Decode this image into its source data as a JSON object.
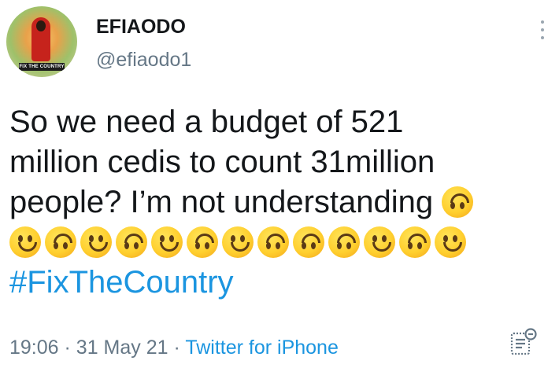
{
  "user": {
    "display_name": "EFIAODO",
    "handle": "@efiaodo1",
    "avatar_caption": "FIX THE COUNTRY"
  },
  "tweet": {
    "lines": [
      "So we need a budget of 521",
      "million cedis to count 31million",
      "people? I’m not understanding"
    ],
    "emoji_row": [
      "slightly-smiling",
      "upside-down",
      "slightly-smiling",
      "upside-down",
      "slightly-smiling",
      "upside-down",
      "slightly-smiling",
      "upside-down",
      "upside-down",
      "upside-down",
      "slightly-smiling",
      "upside-down",
      "slightly-smiling"
    ],
    "hashtag": "#FixTheCountry"
  },
  "meta": {
    "time": "19:06",
    "separator": "·",
    "date": "31 May 21",
    "source": "Twitter for iPhone"
  },
  "icons": {
    "menu": "more-vertical-icon",
    "analytics": "tweet-analytics-icon"
  },
  "colors": {
    "link": "#1b95e0",
    "secondary_text": "#657786",
    "primary_text": "#14171a"
  }
}
